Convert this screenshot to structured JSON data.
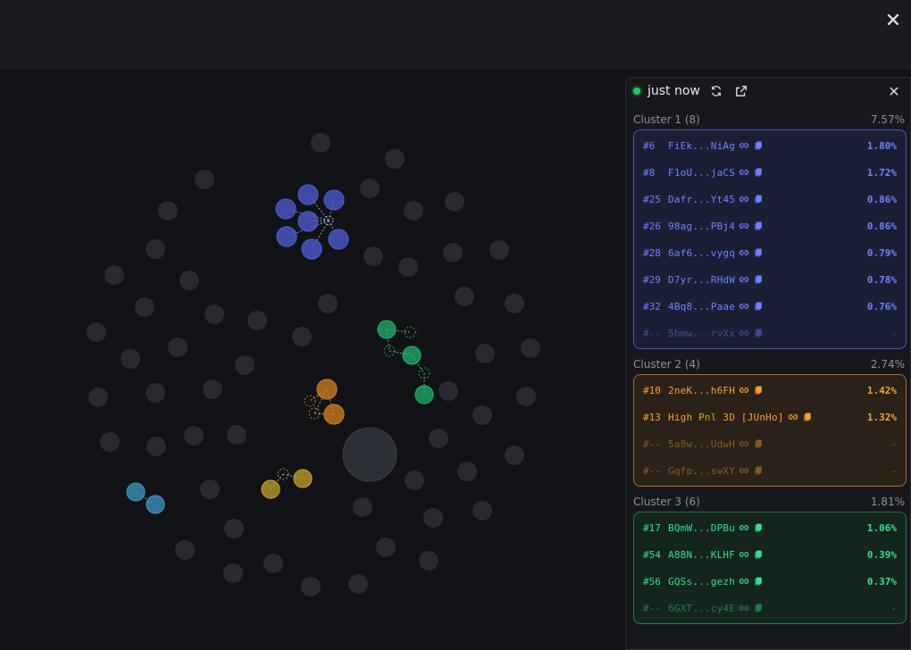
{
  "window": {
    "close_icon": "close-icon"
  },
  "panel": {
    "status": "just now",
    "refresh_icon": "refresh-icon",
    "external_icon": "external-link-icon",
    "close_icon": "close-icon"
  },
  "clusters": [
    {
      "title": "Cluster 1 (8)",
      "total": "7.57%",
      "theme": "blue",
      "rows": [
        {
          "rank": "#6",
          "addr": "FiEk...NiAg",
          "pct": "1.80%",
          "dim": false
        },
        {
          "rank": "#8",
          "addr": "F1oU...jaCS",
          "pct": "1.72%",
          "dim": false
        },
        {
          "rank": "#25",
          "addr": "Dafr...Yt45",
          "pct": "0.86%",
          "dim": false
        },
        {
          "rank": "#26",
          "addr": "98ag...PBj4",
          "pct": "0.86%",
          "dim": false
        },
        {
          "rank": "#28",
          "addr": "6af6...vygq",
          "pct": "0.79%",
          "dim": false
        },
        {
          "rank": "#29",
          "addr": "D7yr...RHdW",
          "pct": "0.78%",
          "dim": false
        },
        {
          "rank": "#32",
          "addr": "4Bq8...Paae",
          "pct": "0.76%",
          "dim": false
        },
        {
          "rank": "#--",
          "addr": "5bmw...rvXx",
          "pct": "-",
          "dim": true
        }
      ]
    },
    {
      "title": "Cluster 2 (4)",
      "total": "2.74%",
      "theme": "orange",
      "rows": [
        {
          "rank": "#10",
          "addr": "2neK...h6FH",
          "pct": "1.42%",
          "dim": false
        },
        {
          "rank": "#13",
          "addr": "High Pnl 3D [JUnHo]",
          "pct": "1.32%",
          "dim": false
        },
        {
          "rank": "#--",
          "addr": "5a8w...UdwH",
          "pct": "-",
          "dim": true
        },
        {
          "rank": "#--",
          "addr": "Gqfp...swXY",
          "pct": "-",
          "dim": true
        }
      ]
    },
    {
      "title": "Cluster 3 (6)",
      "total": "1.81%",
      "theme": "green",
      "rows": [
        {
          "rank": "#17",
          "addr": "BQmW...DPBu",
          "pct": "1.06%",
          "dim": false
        },
        {
          "rank": "#54",
          "addr": "A88N...KLHF",
          "pct": "0.39%",
          "dim": false
        },
        {
          "rank": "#56",
          "addr": "GQSs...gezh",
          "pct": "0.37%",
          "dim": false
        },
        {
          "rank": "#--",
          "addr": "6GXT...cy4E",
          "pct": "-",
          "dim": true
        }
      ]
    }
  ],
  "graph": {
    "colors": {
      "grey": "#30333a",
      "blue": "#4a59c9",
      "orange": "#c8791f",
      "green": "#1fa866",
      "yellow": "#b89a2a",
      "cyan": "#3a8fb8"
    },
    "row_icons": [
      "link-icon",
      "copy-icon"
    ]
  }
}
